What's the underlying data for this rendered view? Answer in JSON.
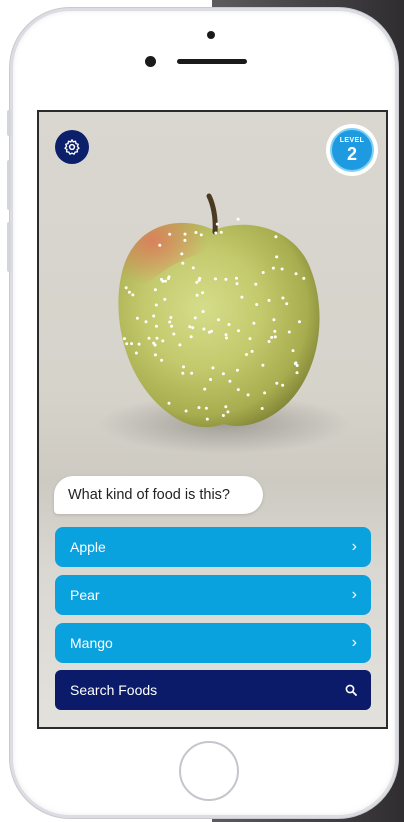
{
  "app": {
    "level": {
      "label": "LEVEL",
      "number": "2"
    },
    "question": "What kind of food is this?",
    "answers": [
      {
        "label": "Apple",
        "icon": "chevron-right-icon"
      },
      {
        "label": "Pear",
        "icon": "chevron-right-icon"
      },
      {
        "label": "Mango",
        "icon": "chevron-right-icon"
      }
    ],
    "search": {
      "label": "Search Foods",
      "icon": "search-icon"
    },
    "settings": {
      "icon": "gear-icon"
    }
  },
  "colors": {
    "answer_button": "#0aa2de",
    "search_button": "#0b1b69",
    "settings_button": "#0b1f6b",
    "level_badge": "#1e9be0"
  }
}
